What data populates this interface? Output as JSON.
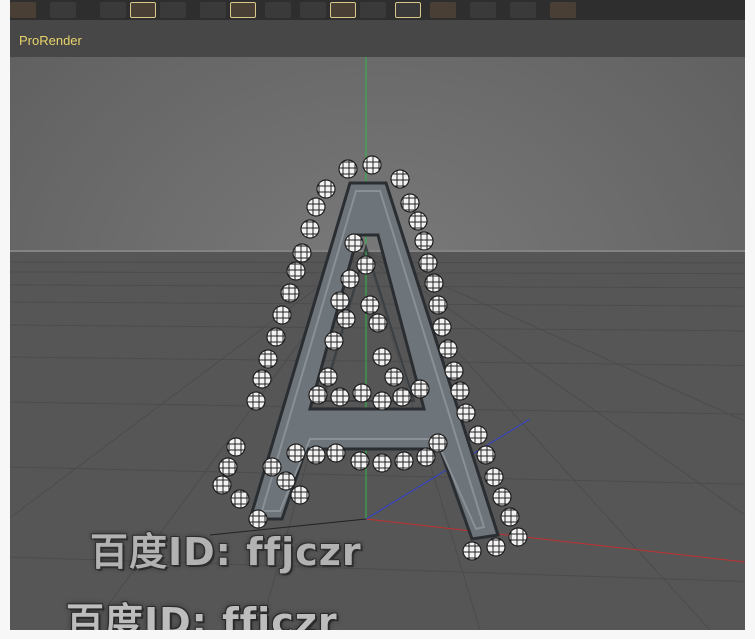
{
  "panel": {
    "title": "ProRender"
  },
  "toolbar": {
    "buttons": [
      {
        "icon": "render-icon"
      },
      {
        "icon": "render-view-icon"
      },
      {
        "icon": "record-icon"
      },
      {
        "icon": "autokey-icon"
      },
      {
        "icon": "keyframe-icon"
      },
      {
        "icon": "cube-icon"
      },
      {
        "icon": "spline-icon"
      },
      {
        "icon": "nurbs-icon"
      },
      {
        "icon": "array-icon"
      },
      {
        "icon": "deformer-icon"
      },
      {
        "icon": "floor-icon"
      },
      {
        "icon": "camera-icon"
      },
      {
        "icon": "light-icon"
      },
      {
        "icon": "sketch-icon"
      },
      {
        "icon": "expression-icon"
      },
      {
        "icon": "menu-icon"
      }
    ]
  },
  "viewport": {
    "colors": {
      "background": "#6a6a6a",
      "grid": "#5a5a5a",
      "horizon": "#a0a0a0",
      "axis_x": "#c03030",
      "axis_y": "#2fb84a",
      "axis_z": "#3040d0",
      "letter": "#6b7278",
      "sphere": "#f0f0f0"
    },
    "object": "letter-A-with-spheres"
  },
  "watermark": {
    "line1": "百度ID: ffjczr",
    "line2": "百度ID: ffjczr"
  }
}
